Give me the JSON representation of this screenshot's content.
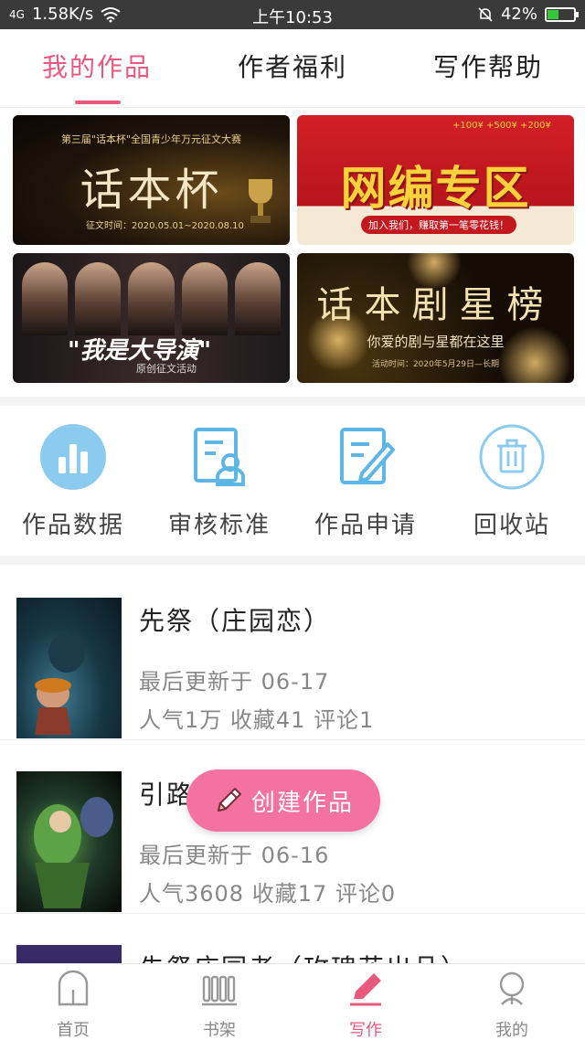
{
  "status_bar": {
    "signal": "4G",
    "net_speed": "1.58K/s",
    "time": "上午10:53",
    "battery": "42%",
    "battery_level": 0.42
  },
  "tabs": [
    {
      "label": "我的作品",
      "active": true
    },
    {
      "label": "作者福利",
      "active": false
    },
    {
      "label": "写作帮助",
      "active": false
    }
  ],
  "banners": {
    "b1": {
      "small": "第三届\"话本杯\"全国青少年万元征文大赛",
      "big": "话本杯",
      "date": "征文时间：2020.05.01~2020.08.10"
    },
    "b2": {
      "big": "网编专区",
      "money": "+100¥  +500¥  +200¥",
      "strip": "加入我们，赚取第一笔零花钱！"
    },
    "b3": {
      "big": "\"我是大导演\"",
      "sub": "原创征文活动"
    },
    "b4": {
      "big": "话本剧星榜",
      "sub": "你爱的剧与星都在这里",
      "date": "活动时间：2020年5月29日—长期"
    }
  },
  "actions": [
    {
      "label": "作品数据",
      "icon": "bar-chart-icon"
    },
    {
      "label": "审核标准",
      "icon": "review-doc-icon"
    },
    {
      "label": "作品申请",
      "icon": "edit-doc-icon"
    },
    {
      "label": "回收站",
      "icon": "trash-icon"
    }
  ],
  "works": [
    {
      "title": "先祭（庄园恋）",
      "updated": "最后更新于 06-17",
      "stats": "人气1万 收藏41 评论1"
    },
    {
      "title": "引路灯（先祭）",
      "updated": "最后更新于 06-16",
      "stats": "人气3608 收藏17 评论0"
    },
    {
      "title": "先祭庄园者（玫瑰花出品）",
      "updated": "",
      "stats": ""
    }
  ],
  "fab": {
    "label": "创建作品",
    "icon": "pencil-icon"
  },
  "bottom_nav": [
    {
      "label": "首页",
      "icon": "home-icon",
      "active": false
    },
    {
      "label": "书架",
      "icon": "bookshelf-icon",
      "active": false
    },
    {
      "label": "写作",
      "icon": "pen-icon",
      "active": true
    },
    {
      "label": "我的",
      "icon": "profile-icon",
      "active": false
    }
  ],
  "colors": {
    "accent": "#e8597d",
    "fab": "#f472a0",
    "icon_blue": "#5eb6e6"
  }
}
